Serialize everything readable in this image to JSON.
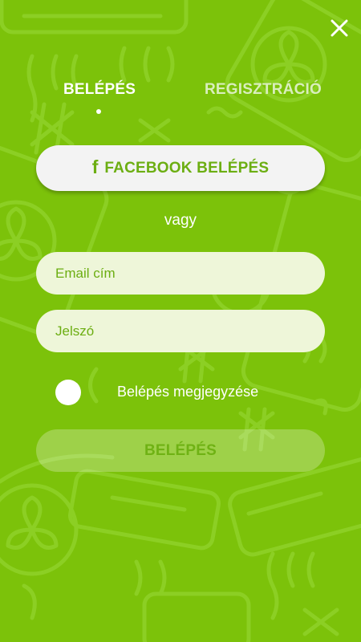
{
  "header": {
    "close_icon": "close-icon"
  },
  "tabs": {
    "login_label": "BELÉPÉS",
    "register_label": "REGISZTRÁCIÓ",
    "active": "login"
  },
  "facebook": {
    "icon_glyph": "f",
    "label": "FACEBOOK BELÉPÉS"
  },
  "divider_text": "vagy",
  "form": {
    "email_placeholder": "Email cím",
    "password_placeholder": "Jelszó",
    "remember_label": "Belépés megjegyzése",
    "submit_label": "BELÉPÉS"
  },
  "colors": {
    "background": "#7cc20a",
    "accent_text": "#6cae12",
    "white": "#ffffff"
  }
}
